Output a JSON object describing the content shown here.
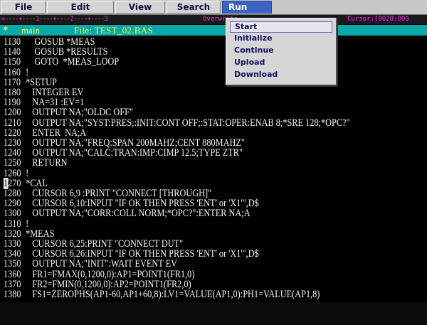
{
  "menubar": {
    "items": [
      {
        "label": "File",
        "active": false
      },
      {
        "label": "Edit",
        "active": false
      },
      {
        "label": "View",
        "active": false
      },
      {
        "label": "Search",
        "active": false
      },
      {
        "label": "Run",
        "active": true
      }
    ]
  },
  "status": {
    "ruler": "=----+----1----+----2----+----3",
    "mode": "Overwrite",
    "cursor": "Cursor:[0028:000"
  },
  "editor": {
    "marker": "*",
    "program": "main",
    "file_title": "File: TEST_02.BAS",
    "lines": [
      {
        "num": "1130",
        "text": "    GOSUB *MEAS"
      },
      {
        "num": "1140",
        "text": "    GOSUB *RESULTS"
      },
      {
        "num": "1150",
        "text": "    GOTO  *MEAS_LOOP"
      },
      {
        "num": "1160",
        "text": "!"
      },
      {
        "num": "1170",
        "text": "*SETUP"
      },
      {
        "num": "1180",
        "text": "   INTEGER EV"
      },
      {
        "num": "1190",
        "text": "   NA=31 :EV=1"
      },
      {
        "num": "1200",
        "text": "   OUTPUT NA;\"OLDC OFF\""
      },
      {
        "num": "1210",
        "text": "   OUTPUT NA;\"SYST:PRES;:INIT:CONT OFF;:STAT:OPER:ENAB 8;*SRE 128;*OPC?\""
      },
      {
        "num": "1220",
        "text": "   ENTER  NA;A"
      },
      {
        "num": "1230",
        "text": "   OUTPUT NA;\"FREQ:SPAN 200MAHZ;CENT 880MAHZ\""
      },
      {
        "num": "1240",
        "text": "   OUTPUT NA;\"CALC:TRAN:IMP:CIMP 12.5;TYPE ZTR\""
      },
      {
        "num": "1250",
        "text": "   RETURN"
      },
      {
        "num": "1260",
        "text": "!"
      },
      {
        "num": "1270",
        "text": "*CAL",
        "cursor": true
      },
      {
        "num": "1280",
        "text": "   CURSOR 6,9 :PRINT \"CONNECT [THROUGH]\""
      },
      {
        "num": "1290",
        "text": "   CURSOR 6,10:INPUT \"IF OK THEN PRESS 'ENT' or 'X1'\",D$"
      },
      {
        "num": "1300",
        "text": "   OUTPUT NA;\"CORR:COLL NORM;*OPC?\":ENTER NA;A"
      },
      {
        "num": "1310",
        "text": "!"
      },
      {
        "num": "1320",
        "text": "*MEAS"
      },
      {
        "num": "1330",
        "text": "   CURSOR 6,25:PRINT \"CONNECT DUT\""
      },
      {
        "num": "1340",
        "text": "   CURSOR 6,26:INPUT \"IF OK THEN PRESS 'ENT' or 'X1'\",D$"
      },
      {
        "num": "1350",
        "text": "   OUTPUT NA;\"INIT\":WAIT EVENT EV"
      },
      {
        "num": "1360",
        "text": "   FR1=FMAX(0,1200,0):AP1=POINT1(FR1,0)"
      },
      {
        "num": "1370",
        "text": "   FR2=FMIN(0,1200,0):AP2=POINT1(FR2,0)"
      },
      {
        "num": "1380",
        "text": "   FS1=ZEROPHS(AP1-60,AP1+60,8):LV1=VALUE(AP1,0):PH1=VALUE(AP1,8)"
      }
    ]
  },
  "run_menu": {
    "items": [
      {
        "label": "Start",
        "selected": true
      },
      {
        "label": "Initialize",
        "selected": false
      },
      {
        "label": "Continue",
        "selected": false
      },
      {
        "label": "Upload",
        "selected": false
      },
      {
        "label": "Download",
        "selected": false
      }
    ]
  },
  "colors": {
    "menubar": "#c8c8c8",
    "menu_active": "#3c63c4",
    "title_bar": "#0aa8a8",
    "title_text": "#ffff40",
    "code_text": "#eeeeee",
    "ruler_text": "#d040d0"
  }
}
